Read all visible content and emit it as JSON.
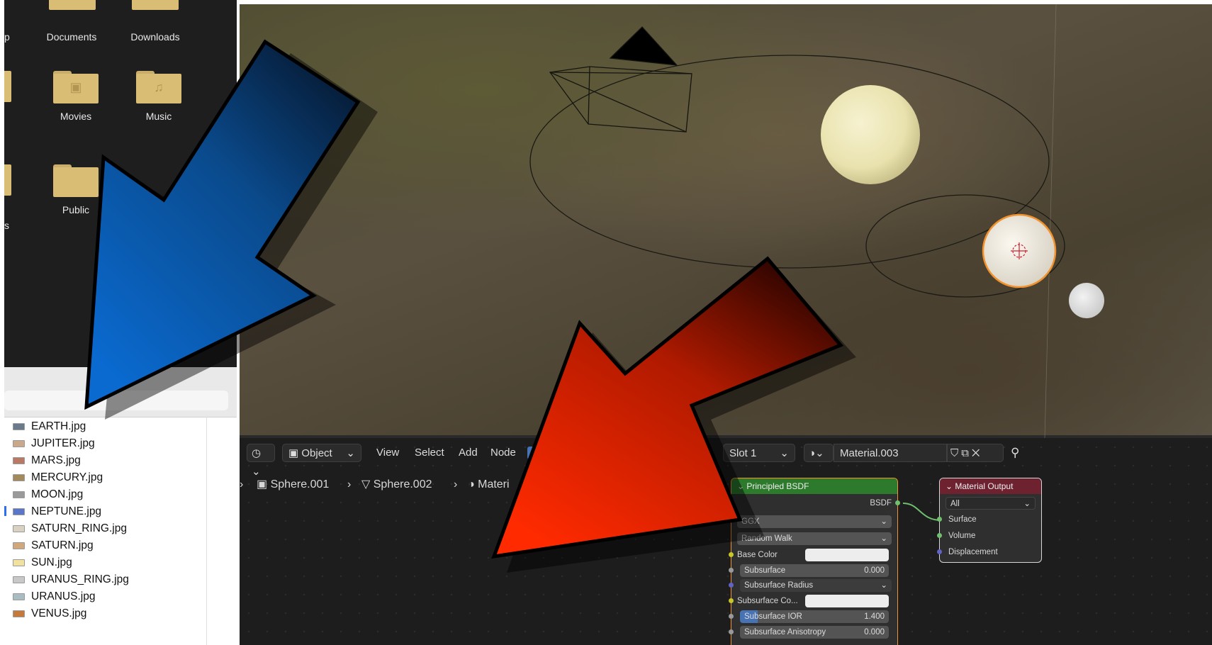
{
  "finder": {
    "folders": [
      {
        "label": "Documents",
        "glyph": ""
      },
      {
        "label": "Downloads",
        "glyph": ""
      },
      {
        "label": "Movies",
        "glyph": "▣"
      },
      {
        "label": "Music",
        "glyph": "♫"
      },
      {
        "label": "Public",
        "glyph": ""
      }
    ],
    "partial_labels": [
      "p",
      "s"
    ],
    "files": [
      {
        "name": "EARTH.jpg",
        "thumb": "#6a7a8a"
      },
      {
        "name": "JUPITER.jpg",
        "thumb": "#c9a98a"
      },
      {
        "name": "MARS.jpg",
        "thumb": "#b87a64"
      },
      {
        "name": "MERCURY.jpg",
        "thumb": "#a38a5c"
      },
      {
        "name": "MOON.jpg",
        "thumb": "#9a9a9a"
      },
      {
        "name": "NEPTUNE.jpg",
        "thumb": "#5a77c7"
      },
      {
        "name": "SATURN_RING.jpg",
        "thumb": "#d9d2c2"
      },
      {
        "name": "SATURN.jpg",
        "thumb": "#d1a87a"
      },
      {
        "name": "SUN.jpg",
        "thumb": "#f2e2a0"
      },
      {
        "name": "URANUS_RING.jpg",
        "thumb": "#c8c8c8"
      },
      {
        "name": "URANUS.jpg",
        "thumb": "#a9bcc2"
      },
      {
        "name": "VENUS.jpg",
        "thumb": "#c47a3a"
      }
    ]
  },
  "node_editor": {
    "header": {
      "mode": "Object",
      "menus": [
        "View",
        "Select",
        "Add",
        "Node"
      ],
      "slot": "Slot 1",
      "material": "Material.003"
    },
    "breadcrumb": [
      "Sphere.001",
      "Sphere.002",
      "Materi"
    ],
    "principled": {
      "title": "Principled BSDF",
      "output": "BSDF",
      "distribution": "GGX",
      "subsurface_method": "Random Walk",
      "base_color_label": "Base Color",
      "subsurface_label": "Subsurface",
      "subsurface_value": "0.000",
      "subsurface_radius_label": "Subsurface Radius",
      "subsurface_color_label": "Subsurface Co...",
      "subsurface_ior_label": "Subsurface IOR",
      "subsurface_ior_value": "1.400",
      "subsurface_anisotropy_label": "Subsurface Anisotropy",
      "subsurface_anisotropy_value": "0.000"
    },
    "output_node": {
      "title": "Material Output",
      "target": "All",
      "inputs": [
        "Surface",
        "Volume",
        "Displacement"
      ]
    }
  },
  "colors": {
    "principled_header": "#2d7a2d",
    "output_header": "#6e2230",
    "selection_outline": "#f0922e",
    "arrow_blue": "#0a66c2",
    "arrow_red": "#ff2a00"
  }
}
